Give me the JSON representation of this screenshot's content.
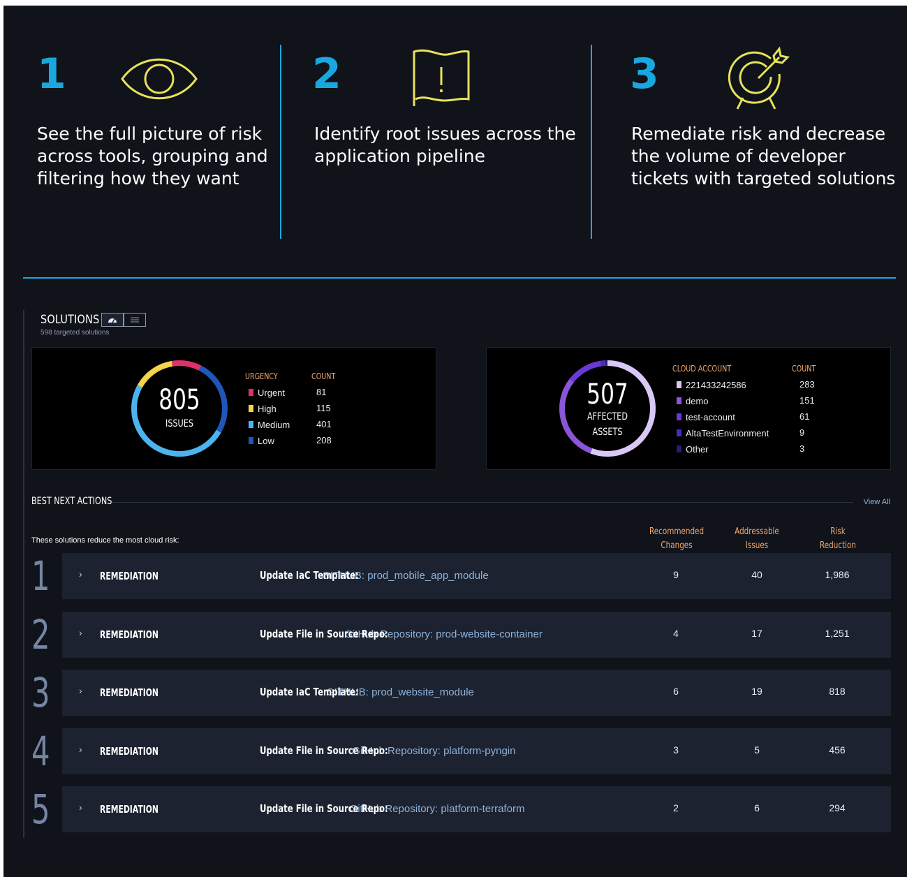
{
  "steps": [
    {
      "number": "1",
      "icon": "eye-icon",
      "text_lines": [
        "See the full picture of risk",
        "across tools, grouping and",
        "filtering how they want"
      ]
    },
    {
      "number": "2",
      "icon": "alert-flag-icon",
      "text_lines": [
        "Identify root issues across the",
        "application pipeline"
      ]
    },
    {
      "number": "3",
      "icon": "target-arrow-icon",
      "text_lines": [
        "Remediate risk and decrease",
        "the volume of developer",
        "tickets with targeted solutions"
      ]
    }
  ],
  "colors": {
    "accent": "#1aa7e0",
    "icon_stroke": "#e8e25a",
    "background": "#10131a",
    "legend_header": "#f2a66a"
  },
  "solutions": {
    "title": "SOLUTIONS",
    "subtitle": "598 targeted solutions",
    "view_toggle": [
      "dashboard-icon",
      "list-icon"
    ]
  },
  "issues_card": {
    "total": "805",
    "total_label": "ISSUES",
    "legend_header": "URGENCY",
    "count_header": "COUNT",
    "items": [
      {
        "label": "Urgent",
        "count": "81",
        "color": "#e0306a"
      },
      {
        "label": "High",
        "count": "115",
        "color": "#f3d44a"
      },
      {
        "label": "Medium",
        "count": "401",
        "color": "#4cb3ef"
      },
      {
        "label": "Low",
        "count": "208",
        "color": "#1f56b8"
      }
    ]
  },
  "assets_card": {
    "total": "507",
    "total_label_1": "AFFECTED",
    "total_label_2": "ASSETS",
    "legend_header": "CLOUD ACCOUNT",
    "count_header": "COUNT",
    "items": [
      {
        "label": "221433242586",
        "count": "283",
        "color": "#d9c8f5"
      },
      {
        "label": "demo",
        "count": "151",
        "color": "#8a55d6"
      },
      {
        "label": "test-account",
        "count": "61",
        "color": "#6a3ad6"
      },
      {
        "label": "AltaTestEnvironment",
        "count": "9",
        "color": "#4a2ac0"
      },
      {
        "label": "Other",
        "count": "3",
        "color": "#2a1a70"
      }
    ]
  },
  "best_next_actions": {
    "title": "BEST NEXT ACTIONS",
    "view_all": "View All",
    "subtitle": "These solutions reduce the most cloud risk:",
    "columns": [
      "Recommended Changes",
      "Addressable Issues",
      "Risk Reduction"
    ],
    "column_lines": [
      [
        "Recommended",
        "Changes"
      ],
      [
        "Addressable",
        "Issues"
      ],
      [
        "Risk",
        "Reduction"
      ]
    ],
    "rows": [
      {
        "rank": "1",
        "type": "REMEDIATION",
        "verb": "Update IaC Template:",
        "target": "GITHUB: prod_mobile_app_module",
        "changes": "9",
        "issues": "40",
        "reduction": "1,986"
      },
      {
        "rank": "2",
        "type": "REMEDIATION",
        "verb": "Update File in Source Repo:",
        "target": "GitHub Repository: prod-website-container",
        "changes": "4",
        "issues": "17",
        "reduction": "1,251"
      },
      {
        "rank": "3",
        "type": "REMEDIATION",
        "verb": "Update IaC Template:",
        "target": "GITHUB: prod_website_module",
        "changes": "6",
        "issues": "19",
        "reduction": "818"
      },
      {
        "rank": "4",
        "type": "REMEDIATION",
        "verb": "Update File in Source Repo:",
        "target": "GitHub Repository: platform-pyngin",
        "changes": "3",
        "issues": "5",
        "reduction": "456"
      },
      {
        "rank": "5",
        "type": "REMEDIATION",
        "verb": "Update File in Source Repo:",
        "target": "GitHub Repository: platform-terraform",
        "changes": "2",
        "issues": "6",
        "reduction": "294"
      }
    ]
  }
}
